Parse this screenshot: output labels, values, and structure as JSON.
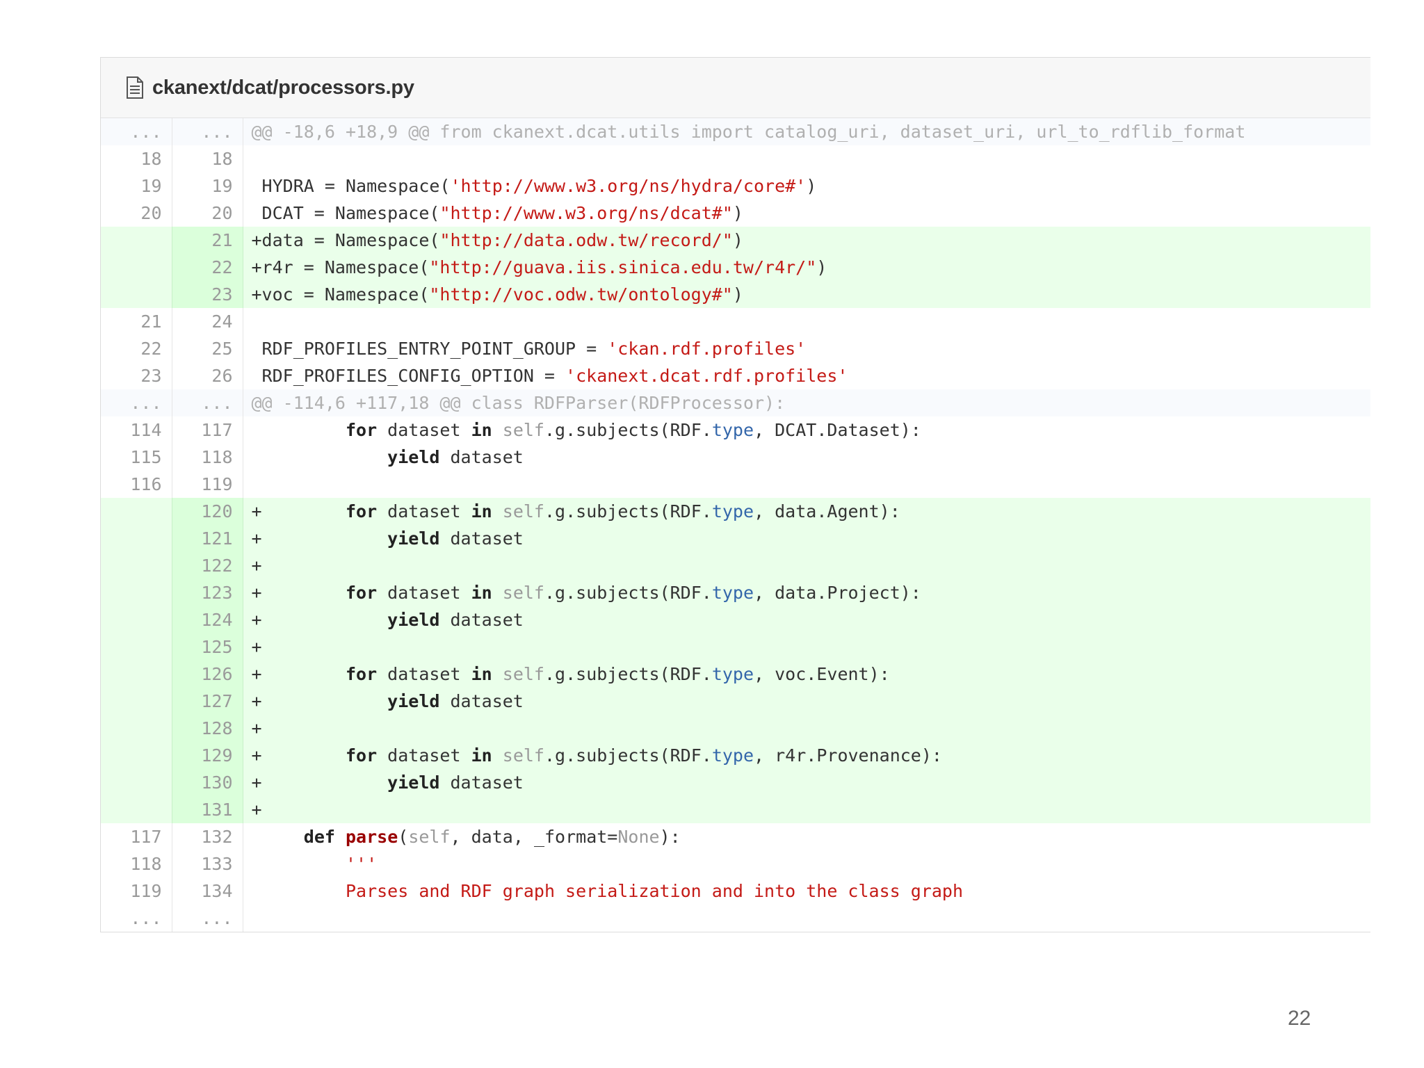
{
  "file": {
    "path": "ckanext/dcat/processors.py",
    "icon": "file-text-icon"
  },
  "slide_number": "22",
  "rows": [
    {
      "type": "hunk",
      "old": "...",
      "new": "...",
      "segs": [
        [
          "@@ -18,6 +18,9 @@ from ckanext.dcat.utils import catalog_uri, dataset_uri, url_to_rdflib_format",
          ""
        ]
      ]
    },
    {
      "type": "ctx",
      "old": "18",
      "new": "18",
      "segs": []
    },
    {
      "type": "ctx",
      "old": "19",
      "new": "19",
      "segs": [
        [
          " HYDRA = Namespace(",
          ""
        ],
        [
          "'http://www.w3.org/ns/hydra/core#'",
          "str"
        ],
        [
          ")",
          ""
        ]
      ]
    },
    {
      "type": "ctx",
      "old": "20",
      "new": "20",
      "segs": [
        [
          " DCAT = Namespace(",
          ""
        ],
        [
          "\"http://www.w3.org/ns/dcat#\"",
          "str"
        ],
        [
          ")",
          ""
        ]
      ]
    },
    {
      "type": "add",
      "old": "",
      "new": "21",
      "segs": [
        [
          "+data = Namespace(",
          ""
        ],
        [
          "\"http://data.odw.tw/record/\"",
          "str"
        ],
        [
          ")",
          ""
        ]
      ]
    },
    {
      "type": "add",
      "old": "",
      "new": "22",
      "segs": [
        [
          "+r4r = Namespace(",
          ""
        ],
        [
          "\"http://guava.iis.sinica.edu.tw/r4r/\"",
          "str"
        ],
        [
          ")",
          ""
        ]
      ]
    },
    {
      "type": "add",
      "old": "",
      "new": "23",
      "segs": [
        [
          "+voc = Namespace(",
          ""
        ],
        [
          "\"http://voc.odw.tw/ontology#\"",
          "str"
        ],
        [
          ")",
          ""
        ]
      ]
    },
    {
      "type": "ctx",
      "old": "21",
      "new": "24",
      "segs": []
    },
    {
      "type": "ctx",
      "old": "22",
      "new": "25",
      "segs": [
        [
          " RDF_PROFILES_ENTRY_POINT_GROUP = ",
          ""
        ],
        [
          "'ckan.rdf.profiles'",
          "str"
        ]
      ]
    },
    {
      "type": "ctx",
      "old": "23",
      "new": "26",
      "segs": [
        [
          " RDF_PROFILES_CONFIG_OPTION = ",
          ""
        ],
        [
          "'ckanext.dcat.rdf.profiles'",
          "str"
        ]
      ]
    },
    {
      "type": "hunk",
      "old": "...",
      "new": "...",
      "segs": [
        [
          "@@ -114,6 +117,18 @@ class RDFParser(RDFProcessor):",
          ""
        ]
      ]
    },
    {
      "type": "ctx",
      "old": "114",
      "new": "117",
      "segs": [
        [
          "         ",
          ""
        ],
        [
          "for",
          "kw"
        ],
        [
          " dataset ",
          ""
        ],
        [
          "in",
          "kw"
        ],
        [
          " ",
          ""
        ],
        [
          "self",
          "self"
        ],
        [
          ".g.subjects(RDF.",
          ""
        ],
        [
          "type",
          "attr"
        ],
        [
          ", DCAT.Dataset):",
          ""
        ]
      ]
    },
    {
      "type": "ctx",
      "old": "115",
      "new": "118",
      "segs": [
        [
          "             ",
          ""
        ],
        [
          "yield",
          "kw"
        ],
        [
          " dataset",
          ""
        ]
      ]
    },
    {
      "type": "ctx",
      "old": "116",
      "new": "119",
      "segs": []
    },
    {
      "type": "add",
      "old": "",
      "new": "120",
      "segs": [
        [
          "+        ",
          ""
        ],
        [
          "for",
          "kw"
        ],
        [
          " dataset ",
          ""
        ],
        [
          "in",
          "kw"
        ],
        [
          " ",
          ""
        ],
        [
          "self",
          "self"
        ],
        [
          ".g.subjects(RDF.",
          ""
        ],
        [
          "type",
          "attr"
        ],
        [
          ", data.Agent):",
          ""
        ]
      ]
    },
    {
      "type": "add",
      "old": "",
      "new": "121",
      "segs": [
        [
          "+            ",
          ""
        ],
        [
          "yield",
          "kw"
        ],
        [
          " dataset",
          ""
        ]
      ]
    },
    {
      "type": "add",
      "old": "",
      "new": "122",
      "segs": [
        [
          "+",
          ""
        ]
      ]
    },
    {
      "type": "add",
      "old": "",
      "new": "123",
      "segs": [
        [
          "+        ",
          ""
        ],
        [
          "for",
          "kw"
        ],
        [
          " dataset ",
          ""
        ],
        [
          "in",
          "kw"
        ],
        [
          " ",
          ""
        ],
        [
          "self",
          "self"
        ],
        [
          ".g.subjects(RDF.",
          ""
        ],
        [
          "type",
          "attr"
        ],
        [
          ", data.Project):",
          ""
        ]
      ]
    },
    {
      "type": "add",
      "old": "",
      "new": "124",
      "segs": [
        [
          "+            ",
          ""
        ],
        [
          "yield",
          "kw"
        ],
        [
          " dataset",
          ""
        ]
      ]
    },
    {
      "type": "add",
      "old": "",
      "new": "125",
      "segs": [
        [
          "+",
          ""
        ]
      ]
    },
    {
      "type": "add",
      "old": "",
      "new": "126",
      "segs": [
        [
          "+        ",
          ""
        ],
        [
          "for",
          "kw"
        ],
        [
          " dataset ",
          ""
        ],
        [
          "in",
          "kw"
        ],
        [
          " ",
          ""
        ],
        [
          "self",
          "self"
        ],
        [
          ".g.subjects(RDF.",
          ""
        ],
        [
          "type",
          "attr"
        ],
        [
          ", voc.Event):",
          ""
        ]
      ]
    },
    {
      "type": "add",
      "old": "",
      "new": "127",
      "segs": [
        [
          "+            ",
          ""
        ],
        [
          "yield",
          "kw"
        ],
        [
          " dataset",
          ""
        ]
      ]
    },
    {
      "type": "add",
      "old": "",
      "new": "128",
      "segs": [
        [
          "+",
          ""
        ]
      ]
    },
    {
      "type": "add",
      "old": "",
      "new": "129",
      "segs": [
        [
          "+        ",
          ""
        ],
        [
          "for",
          "kw"
        ],
        [
          " dataset ",
          ""
        ],
        [
          "in",
          "kw"
        ],
        [
          " ",
          ""
        ],
        [
          "self",
          "self"
        ],
        [
          ".g.subjects(RDF.",
          ""
        ],
        [
          "type",
          "attr"
        ],
        [
          ", r4r.Provenance):",
          ""
        ]
      ]
    },
    {
      "type": "add",
      "old": "",
      "new": "130",
      "segs": [
        [
          "+            ",
          ""
        ],
        [
          "yield",
          "kw"
        ],
        [
          " dataset",
          ""
        ]
      ]
    },
    {
      "type": "add",
      "old": "",
      "new": "131",
      "segs": [
        [
          "+",
          ""
        ]
      ]
    },
    {
      "type": "ctx",
      "old": "117",
      "new": "132",
      "segs": [
        [
          "     ",
          ""
        ],
        [
          "def",
          "kw"
        ],
        [
          " ",
          ""
        ],
        [
          "parse",
          "fn"
        ],
        [
          "(",
          ""
        ],
        [
          "self",
          "self"
        ],
        [
          ", data, _format=",
          ""
        ],
        [
          "None",
          "none"
        ],
        [
          "):",
          ""
        ]
      ]
    },
    {
      "type": "ctx",
      "old": "118",
      "new": "133",
      "segs": [
        [
          "         ",
          ""
        ],
        [
          "'''",
          "doc"
        ]
      ]
    },
    {
      "type": "ctx",
      "old": "119",
      "new": "134",
      "segs": [
        [
          "         ",
          ""
        ],
        [
          "Parses and RDF graph serialization and into the class graph",
          "doc"
        ]
      ]
    },
    {
      "type": "ctx",
      "old": "...",
      "new": "...",
      "segs": []
    }
  ]
}
